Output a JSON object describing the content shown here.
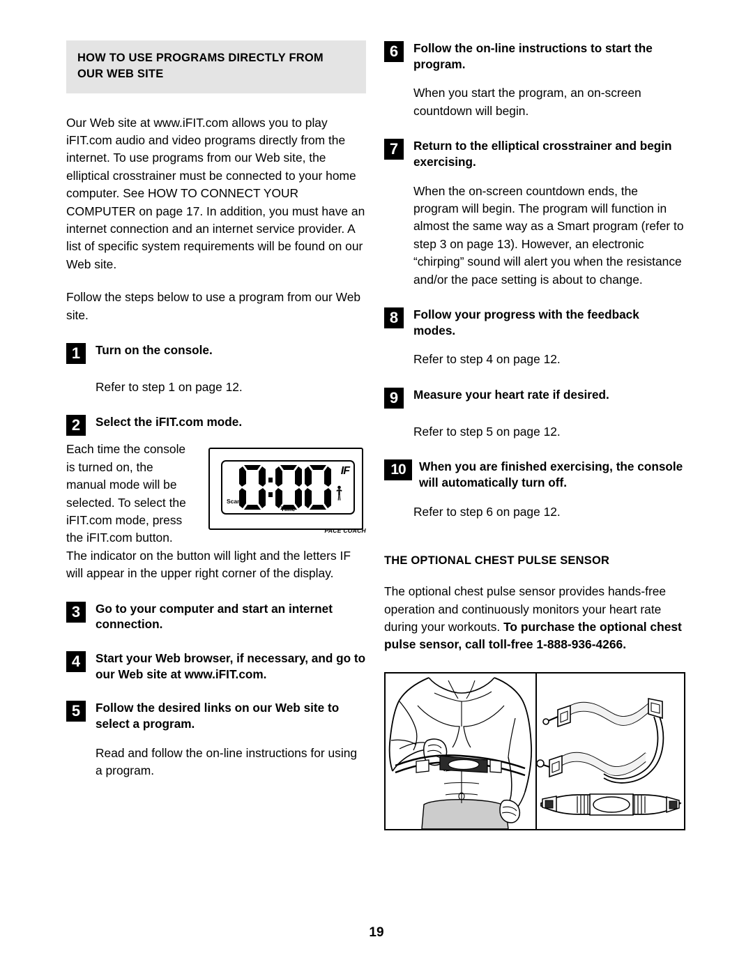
{
  "page": {
    "number": "19",
    "band_heading_line1": "HOW TO USE PROGRAMS DIRECTLY FROM",
    "band_heading_line2": "OUR WEB SITE"
  },
  "left_column": {
    "intro_paragraph": "Our Web site at www.iFIT.com allows you to play iFIT.com audio and video programs directly from the internet. To use programs from our Web site, the elliptical crosstrainer must be connected to your home computer. See HOW TO CONNECT YOUR COMPUTER on page 17. In addition, you must have an internet connection and an internet service provider. A list of specific system requirements will be found on our Web site.",
    "follow_steps_paragraph": "Follow the steps below to use a program from our Web site.",
    "steps": [
      {
        "number": "1",
        "title": "Turn on the console.",
        "note": "Refer to step 1 on page 12."
      },
      {
        "number": "2",
        "title": "Select the iFIT.com mode.",
        "note_wrap": "Each time the console is turned on, the manual mode will be selected. To select the iFIT.com mode, press the iFIT.com button. The indicator on the button will light and the letters IF will appear in the upper right corner of the display."
      },
      {
        "number": "3",
        "title": "Go to your computer and start an internet connection."
      },
      {
        "number": "4",
        "title": "Start your Web browser, if necessary, and go to our Web site at www.iFIT.com."
      },
      {
        "number": "5",
        "title": "Follow the desired links on our Web site to select a program.",
        "note": "Read and follow the on-line instructions for using a program."
      }
    ],
    "console_display": {
      "digits": "0:00",
      "ifit_indicator": "IF",
      "scan_label": "Scan",
      "time_label": "Time",
      "pace_coach_label": "PACE COACH"
    }
  },
  "right_column": {
    "steps": [
      {
        "number": "6",
        "title": "Follow the on-line instructions to start the program.",
        "note": "When you start the program, an on-screen countdown will begin."
      },
      {
        "number": "7",
        "title": "Return to the elliptical crosstrainer and begin exercising.",
        "note": "When the on-screen countdown ends, the program will begin. The program will function in almost the same way as a Smart program (refer to step 3 on page 13). However, an electronic “chirping” sound will alert you when the resistance and/or the pace setting is about to change."
      },
      {
        "number": "8",
        "title": "Follow your progress with the feedback modes.",
        "note": "Refer to step 4 on page 12."
      },
      {
        "number": "9",
        "title": "Measure your heart rate if desired.",
        "note": "Refer to step 5 on page 12."
      },
      {
        "number": "10",
        "title": "When you are finished exercising, the console will automatically turn off.",
        "note": "Refer to step 6 on page 12."
      }
    ],
    "chest_sensor": {
      "heading": "THE OPTIONAL CHEST PULSE SENSOR",
      "paragraph_normal": "The optional chest pulse sensor provides hands-free operation and continuously monitors your heart rate during your workouts. ",
      "paragraph_bold": "To purchase the optional chest pulse sensor, call toll-free 1-888-936-4266.",
      "phone": "1-888-936-4266"
    }
  },
  "colors": {
    "band_background": "#e4e4e4",
    "badge_background": "#000000",
    "badge_text": "#ffffff",
    "text": "#000000",
    "illustration_shorts": "#cccccc"
  }
}
